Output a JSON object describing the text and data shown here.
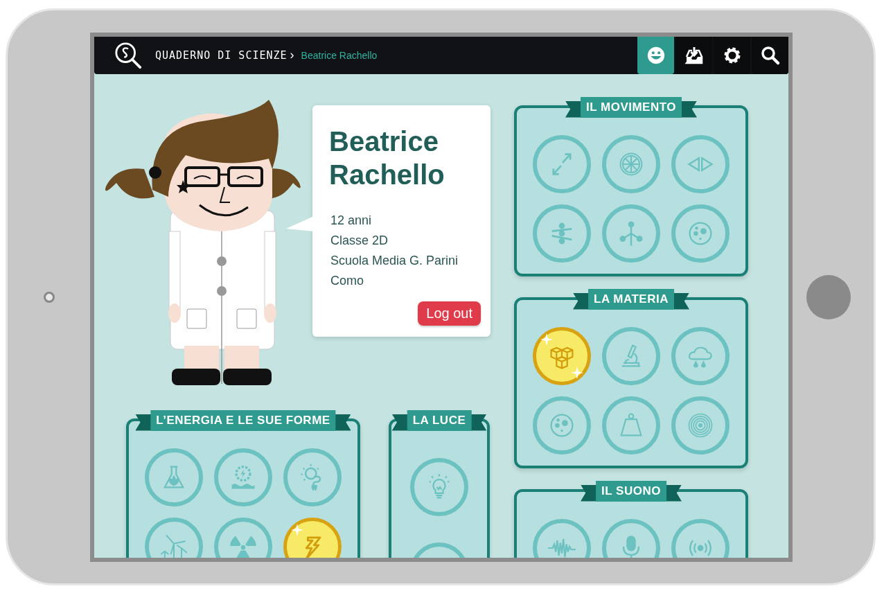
{
  "top_bar": {
    "app_title": "QUADERNO DI SCIENZE",
    "separator": "›",
    "current_user": "Beatrice Rachello",
    "buttons": [
      {
        "kind": "smiley",
        "selected": true
      },
      {
        "kind": "inbox",
        "selected": false
      },
      {
        "kind": "settings",
        "selected": false
      },
      {
        "kind": "search",
        "selected": false
      }
    ]
  },
  "profile": {
    "name": "Beatrice Rachello",
    "details": [
      "12 anni",
      "Classe 2D",
      "Scuola Media G. Parini",
      "Como"
    ],
    "logout_button": "Log out"
  },
  "main_sections": [
    {
      "title": "L’ENERGIA E LE SUE FORME",
      "badges": [
        {
          "kind": "flask",
          "earned": false
        },
        {
          "kind": "turbine",
          "earned": false
        },
        {
          "kind": "sun-plug",
          "earned": false
        },
        {
          "kind": "wind",
          "earned": false
        },
        {
          "kind": "radiation",
          "earned": false
        },
        {
          "kind": "lightning",
          "earned": true
        }
      ]
    },
    {
      "title": "LA LUCE",
      "badges": [
        {
          "kind": "bulb",
          "earned": false
        },
        {
          "kind": "blank",
          "earned": false
        }
      ]
    }
  ],
  "side_sections": [
    {
      "title": "IL MOVIMENTO",
      "badges": [
        {
          "kind": "arrows",
          "earned": false
        },
        {
          "kind": "wheel",
          "earned": false
        },
        {
          "kind": "triangles",
          "earned": false
        },
        {
          "kind": "balance",
          "earned": false
        },
        {
          "kind": "molecule",
          "earned": false
        },
        {
          "kind": "cell",
          "earned": false
        }
      ]
    },
    {
      "title": "LA MATERIA",
      "badges": [
        {
          "kind": "cubes",
          "earned": true
        },
        {
          "kind": "microscope",
          "earned": false
        },
        {
          "kind": "rain",
          "earned": false
        },
        {
          "kind": "cell",
          "earned": false
        },
        {
          "kind": "weight",
          "earned": false
        },
        {
          "kind": "rings",
          "earned": false
        }
      ]
    },
    {
      "title": "IL SUONO",
      "badges": [
        {
          "kind": "wave",
          "earned": false
        },
        {
          "kind": "mic",
          "earned": false
        },
        {
          "kind": "signal",
          "earned": false
        }
      ]
    }
  ]
}
